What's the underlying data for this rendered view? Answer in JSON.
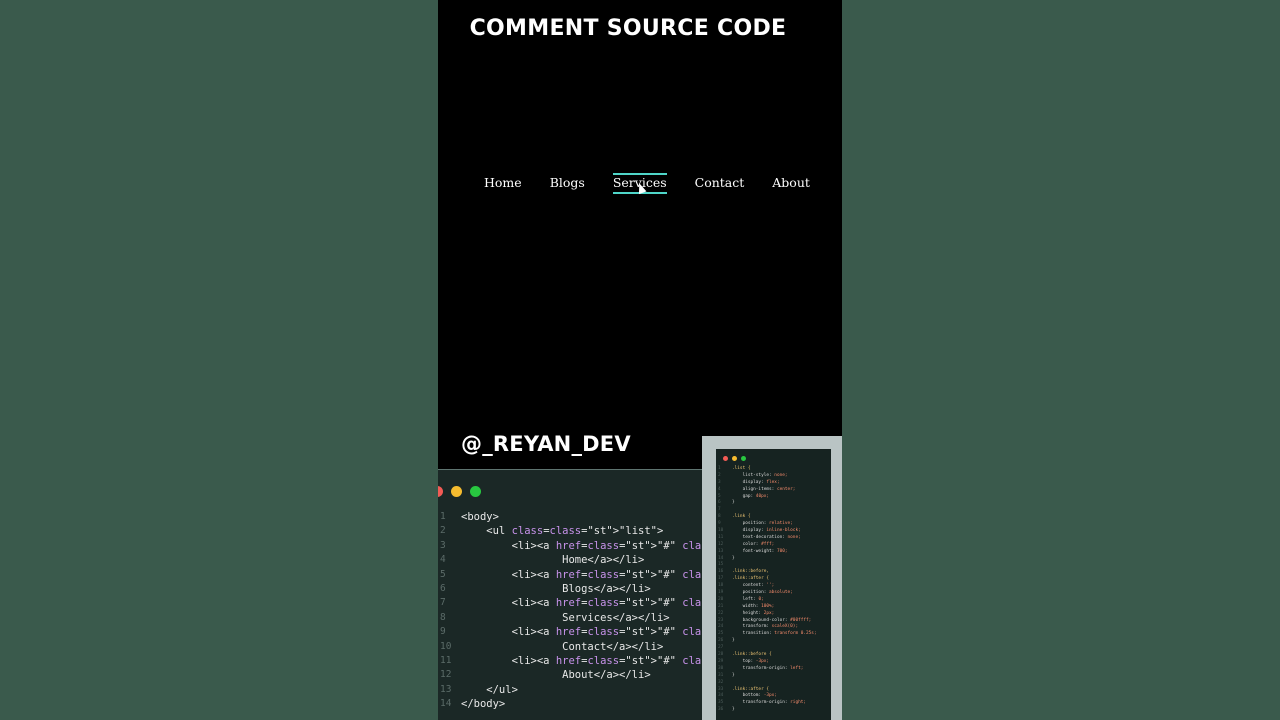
{
  "header": {
    "title": "COMMENT SOURCE CODE"
  },
  "nav": {
    "items": [
      {
        "label": "Home"
      },
      {
        "label": "Blogs"
      },
      {
        "label": "Services",
        "active": true
      },
      {
        "label": "Contact"
      },
      {
        "label": "About"
      }
    ]
  },
  "handle": "@_REYAN_DEV",
  "colors": {
    "accent": "#4fd6c9",
    "background": "#000000",
    "page_bg": "#3a5a4c"
  },
  "html_code": {
    "lines": [
      {
        "n": "1",
        "text": "<body>"
      },
      {
        "n": "2",
        "text": "    <ul class=\"list\">"
      },
      {
        "n": "3",
        "text": "        <li><a href=\"#\" class=\"link\">"
      },
      {
        "n": "4",
        "text": "                Home</a></li>"
      },
      {
        "n": "5",
        "text": "        <li><a href=\"#\" class=\"link  \">"
      },
      {
        "n": "6",
        "text": "                Blogs</a></li>"
      },
      {
        "n": "7",
        "text": "        <li><a href=\"#\" class=\"link\">"
      },
      {
        "n": "8",
        "text": "                Services</a></li>"
      },
      {
        "n": "9",
        "text": "        <li><a href=\"#\" class=\"link \">"
      },
      {
        "n": "10",
        "text": "                Contact</a></li>"
      },
      {
        "n": "11",
        "text": "        <li><a href=\"#\" class=\"link\">"
      },
      {
        "n": "12",
        "text": "                About</a></li>"
      },
      {
        "n": "13",
        "text": "    </ul>"
      },
      {
        "n": "14",
        "text": "</body>"
      }
    ]
  },
  "css_code": {
    "lines": [
      {
        "n": "1",
        "text": ".list {"
      },
      {
        "n": "2",
        "text": "    list-style: none;"
      },
      {
        "n": "3",
        "text": "    display: flex;"
      },
      {
        "n": "4",
        "text": "    align-items: center;"
      },
      {
        "n": "5",
        "text": "    gap: 40px;"
      },
      {
        "n": "6",
        "text": "}"
      },
      {
        "n": "7",
        "text": ""
      },
      {
        "n": "8",
        "text": ".link {"
      },
      {
        "n": "9",
        "text": "    position: relative;"
      },
      {
        "n": "10",
        "text": "    display: inline-block;"
      },
      {
        "n": "11",
        "text": "    text-decoration: none;"
      },
      {
        "n": "12",
        "text": "    color: #fff;"
      },
      {
        "n": "13",
        "text": "    font-weight: 700;"
      },
      {
        "n": "14",
        "text": "}"
      },
      {
        "n": "15",
        "text": ""
      },
      {
        "n": "16",
        "text": ".link::before,"
      },
      {
        "n": "17",
        "text": ".link::after {"
      },
      {
        "n": "18",
        "text": "    content: '';"
      },
      {
        "n": "19",
        "text": "    position: absolute;"
      },
      {
        "n": "20",
        "text": "    left: 0;"
      },
      {
        "n": "21",
        "text": "    width: 100%;"
      },
      {
        "n": "22",
        "text": "    height: 2px;"
      },
      {
        "n": "23",
        "text": "    background-color: #00ffff;"
      },
      {
        "n": "24",
        "text": "    transform: scaleX(0);"
      },
      {
        "n": "25",
        "text": "    transition: transform 0.25s;"
      },
      {
        "n": "26",
        "text": "}"
      },
      {
        "n": "27",
        "text": ""
      },
      {
        "n": "28",
        "text": ".link::before {"
      },
      {
        "n": "29",
        "text": "    top: -3px;"
      },
      {
        "n": "30",
        "text": "    transform-origin: left;"
      },
      {
        "n": "31",
        "text": "}"
      },
      {
        "n": "32",
        "text": ""
      },
      {
        "n": "33",
        "text": ".link::after {"
      },
      {
        "n": "34",
        "text": "    bottom: -3px;"
      },
      {
        "n": "35",
        "text": "    transform-origin: right;"
      },
      {
        "n": "36",
        "text": "}"
      }
    ]
  }
}
